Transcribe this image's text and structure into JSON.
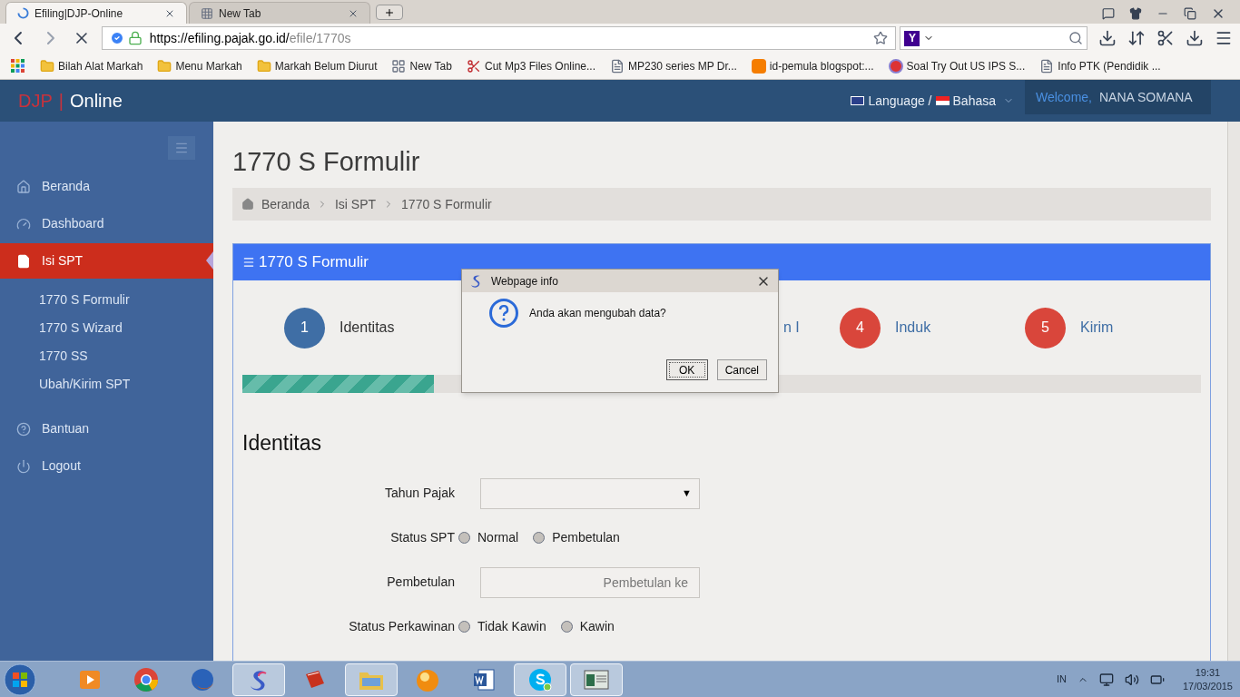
{
  "browser": {
    "tabs": [
      {
        "title": "Efiling|DJP-Online",
        "selected": true,
        "loading": true
      },
      {
        "title": "New Tab",
        "selected": false,
        "loading": false
      }
    ],
    "url": {
      "host": "https://efiling.pajak.go.id/",
      "path": "efile/1770s"
    },
    "search_engine": "Y",
    "bookmarks": [
      {
        "label": "Bilah Alat Markah",
        "kind": "folder"
      },
      {
        "label": "Menu Markah",
        "kind": "folder"
      },
      {
        "label": "Markah Belum Diurut",
        "kind": "folder"
      },
      {
        "label": "New Tab",
        "kind": "grid"
      },
      {
        "label": "Cut Mp3 Files Online...",
        "kind": "scissors"
      },
      {
        "label": "MP230 series MP Dr...",
        "kind": "page"
      },
      {
        "label": "id-pemula blogspot:...",
        "kind": "blog"
      },
      {
        "label": "Soal Try Out US IPS S...",
        "kind": "m"
      },
      {
        "label": "Info PTK (Pendidik ...",
        "kind": "page"
      }
    ]
  },
  "header": {
    "logo_left": "DJP",
    "logo_separator": "|",
    "logo_right": "Online",
    "language": "Language /",
    "bahasa": "Bahasa",
    "welcome": "Welcome,",
    "user": "NANA SOMANA"
  },
  "sidebar": {
    "items": [
      {
        "label": "Beranda",
        "selected": false
      },
      {
        "label": "Dashboard",
        "selected": false
      },
      {
        "label": "Isi SPT",
        "selected": true,
        "children": [
          {
            "label": "1770 S Formulir",
            "selected": false
          },
          {
            "label": "1770 S Wizard",
            "selected": false
          },
          {
            "label": "1770 SS",
            "selected": false
          },
          {
            "label": "Ubah/Kirim SPT",
            "selected": false
          }
        ]
      },
      {
        "label": "Bantuan",
        "selected": false
      },
      {
        "label": "Logout",
        "selected": false
      }
    ]
  },
  "page_title": "1770 S Formulir",
  "breadcrumb": [
    "Beranda",
    "Isi SPT",
    "1770 S Formulir"
  ],
  "panel": {
    "title": "1770 S Formulir",
    "steps": [
      {
        "number": "1",
        "label": "Identitas",
        "color": "#3f6ea5"
      },
      {
        "label": "n I"
      },
      {
        "number": "4",
        "label": "Induk",
        "color": "#d9463b"
      },
      {
        "number": "5",
        "label": "Kirim",
        "color": "#d9463b"
      }
    ],
    "progress": {
      "level": 0.2
    },
    "section_title": "Identitas",
    "form": [
      {
        "kind": "select",
        "label": "Tahun Pajak",
        "arrow": "▼"
      },
      {
        "kind": "radio",
        "label": "Status SPT",
        "options": [
          {
            "label": "Normal",
            "selected": false
          },
          {
            "label": "Pembetulan",
            "selected": false
          }
        ]
      },
      {
        "kind": "input",
        "label": "Pembetulan",
        "placeholder": "Pembetulan ke"
      },
      {
        "kind": "radio",
        "label": "Status Perkawinan",
        "options": [
          {
            "label": "Tidak Kawin",
            "selected": false
          },
          {
            "label": "Kawin",
            "selected": false
          }
        ]
      }
    ]
  },
  "dialog": {
    "title": "Webpage info",
    "message": "Anda akan mengubah data?",
    "buttons": [
      {
        "label": "OK",
        "focused": true
      },
      {
        "label": "Cancel",
        "focused": false
      }
    ]
  },
  "taskbar": {
    "apps": [
      {
        "running": false
      },
      {
        "running": false
      },
      {
        "running": false
      },
      {
        "running": true
      },
      {
        "running": false
      },
      {
        "running": true
      },
      {
        "running": false
      },
      {
        "running": false
      },
      {
        "running": true
      },
      {
        "running": true
      }
    ],
    "language": "IN",
    "time": "19:31",
    "date": "17/03/2015"
  }
}
